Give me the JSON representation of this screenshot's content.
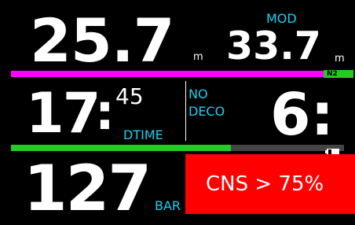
{
  "depth": {
    "value": "25.7",
    "unit": "m"
  },
  "mod": {
    "label": "MOD",
    "value": "33.7",
    "unit": "m"
  },
  "o2_bar": {
    "gas_label": "N2",
    "color": "#ff00ff",
    "label_bg": "#22cc22"
  },
  "dive_time": {
    "minutes": "17",
    "seconds": "45",
    "label": "DTIME"
  },
  "deco": {
    "label_line1": "NO",
    "label_line2": "DECO",
    "value": "6:"
  },
  "tissue_bar": {
    "fill_fraction": 0.66,
    "fill_color": "#22cc22",
    "icon": "battery-icon"
  },
  "pressure": {
    "value": "127",
    "unit": "BAR"
  },
  "cns_alert": {
    "text": "CNS > 75%",
    "bg_color": "#ff0000"
  }
}
